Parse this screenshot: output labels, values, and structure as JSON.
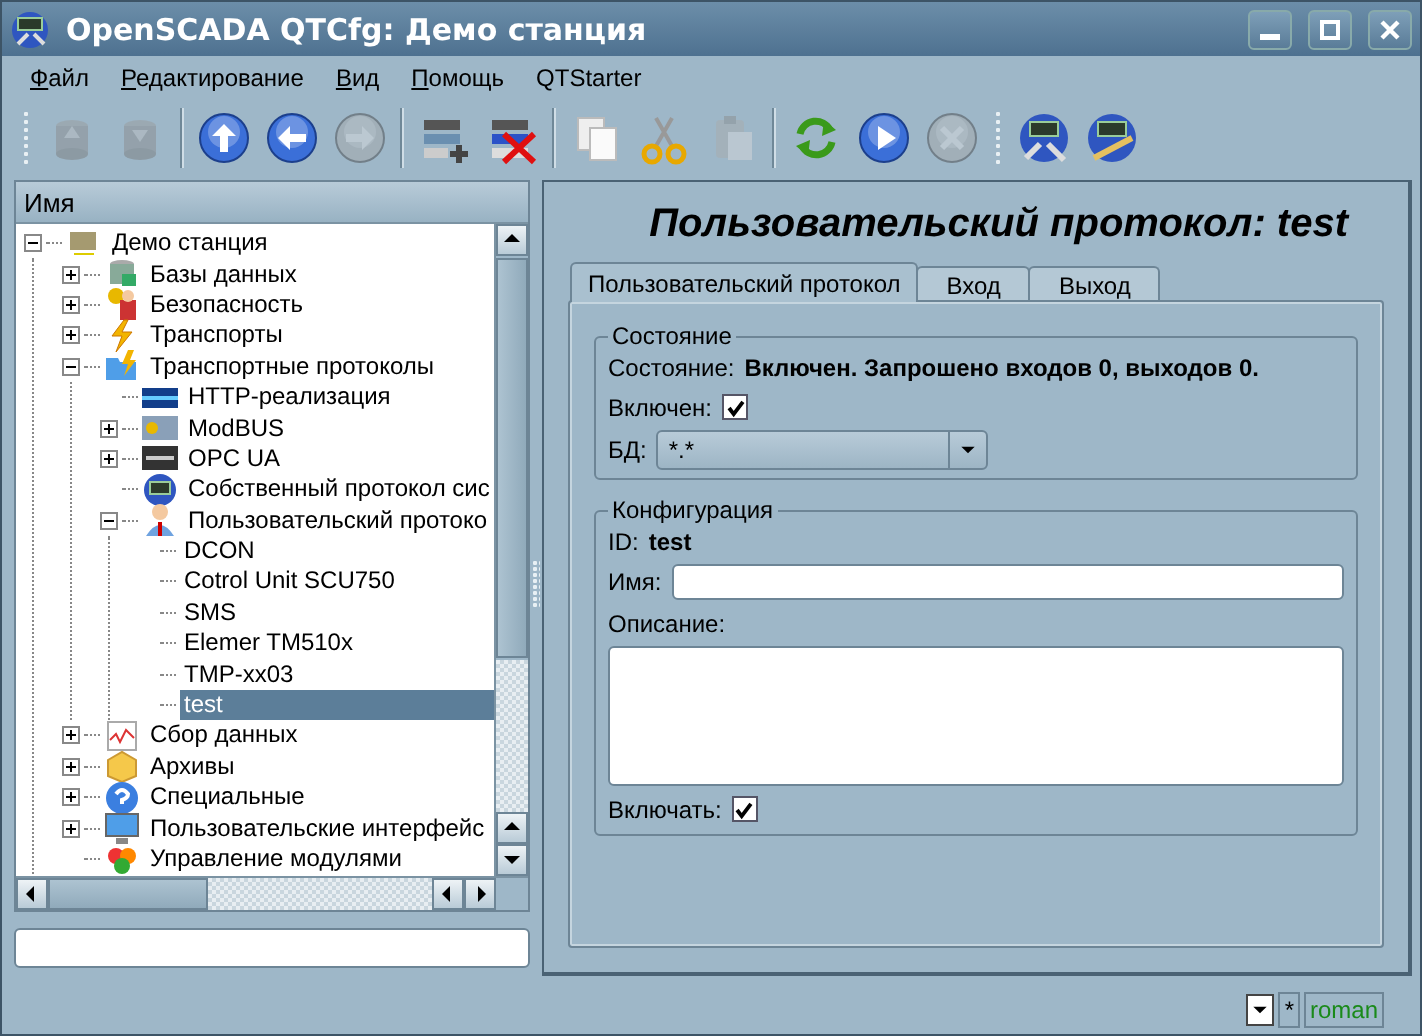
{
  "window": {
    "title": "OpenSCADA QTCfg: Демо станция"
  },
  "menu": [
    {
      "label": "Файл",
      "mnemonic": true
    },
    {
      "label": "Редактирование",
      "mnemonic": true
    },
    {
      "label": "Вид",
      "mnemonic": true
    },
    {
      "label": "Помощь",
      "mnemonic": true
    },
    {
      "label": "QTStarter",
      "mnemonic": false
    }
  ],
  "toolbar": [
    [
      {
        "kind": "load",
        "disabled": true
      },
      {
        "kind": "save",
        "disabled": true
      }
    ],
    [
      {
        "kind": "up",
        "disabled": false
      },
      {
        "kind": "back",
        "disabled": false
      },
      {
        "kind": "forward",
        "disabled": true
      }
    ],
    [
      {
        "kind": "add",
        "disabled": false
      },
      {
        "kind": "remove",
        "disabled": false
      }
    ],
    [
      {
        "kind": "copy",
        "disabled": false
      },
      {
        "kind": "cut",
        "disabled": false
      },
      {
        "kind": "paste",
        "disabled": true
      }
    ],
    [
      {
        "kind": "refresh",
        "disabled": false
      },
      {
        "kind": "start",
        "disabled": false
      },
      {
        "kind": "stop",
        "disabled": true
      }
    ],
    [
      {
        "kind": "connect",
        "disabled": false
      },
      {
        "kind": "configure",
        "disabled": false
      }
    ]
  ],
  "tree": {
    "header": "Имя",
    "items": [
      {
        "label": "Демо станция",
        "kind": "station",
        "expanded": true,
        "selected": false,
        "children": [
          {
            "label": "Базы данных",
            "kind": "database",
            "expanded": false,
            "selected": false
          },
          {
            "label": "Безопасность",
            "kind": "security",
            "expanded": false,
            "selected": false
          },
          {
            "label": "Транспорты",
            "kind": "transport",
            "expanded": false,
            "selected": false
          },
          {
            "label": "Транспортные протоколы",
            "kind": "protocols",
            "expanded": true,
            "selected": false,
            "children": [
              {
                "label": "HTTP-реализация",
                "kind": "http",
                "selected": false
              },
              {
                "label": "ModBUS",
                "kind": "modbus",
                "expanded": false,
                "selected": false
              },
              {
                "label": "OPC UA",
                "kind": "opc",
                "expanded": false,
                "selected": false
              },
              {
                "label": "Собственный протокол сис",
                "kind": "selfproto",
                "selected": false
              },
              {
                "label": "Пользовательский протоко",
                "kind": "userproto",
                "expanded": true,
                "selected": false,
                "children": [
                  {
                    "label": "DCON",
                    "selected": false
                  },
                  {
                    "label": "Cotrol Unit SCU750",
                    "selected": false
                  },
                  {
                    "label": "SMS",
                    "selected": false
                  },
                  {
                    "label": "Elemer TM510x",
                    "selected": false
                  },
                  {
                    "label": "TMP-xx03",
                    "selected": false
                  },
                  {
                    "label": "test",
                    "selected": true
                  }
                ]
              }
            ]
          },
          {
            "label": "Сбор данных",
            "kind": "daq",
            "expanded": false,
            "selected": false
          },
          {
            "label": "Архивы",
            "kind": "archive",
            "expanded": false,
            "selected": false
          },
          {
            "label": "Специальные",
            "kind": "special",
            "expanded": false,
            "selected": false
          },
          {
            "label": "Пользовательские интерфейс",
            "kind": "ui",
            "expanded": false,
            "selected": false
          },
          {
            "label": "Управление модулями",
            "kind": "modules",
            "selected": false
          }
        ]
      }
    ]
  },
  "panel": {
    "title": "Пользовательский протокол: test",
    "tabs": [
      {
        "label": "Пользовательский протокол",
        "selected": true
      },
      {
        "label": "Вход",
        "selected": false
      },
      {
        "label": "Выход",
        "selected": false
      }
    ],
    "state_group": {
      "title": "Состояние",
      "status_label": "Состояние:",
      "status_value": "Включен. Запрошено входов 0, выходов 0.",
      "enabled_label": "Включен:",
      "enabled_checked": true,
      "db_label": "БД:",
      "db_value": "*.*"
    },
    "config_group": {
      "title": "Конфигурация",
      "id_label": "ID:",
      "id_value": "test",
      "name_label": "Имя:",
      "description_label": "Описание:",
      "include_label": "Включать:",
      "include_checked": true
    }
  },
  "status_bar": {
    "modified": "*",
    "user": "roman"
  }
}
